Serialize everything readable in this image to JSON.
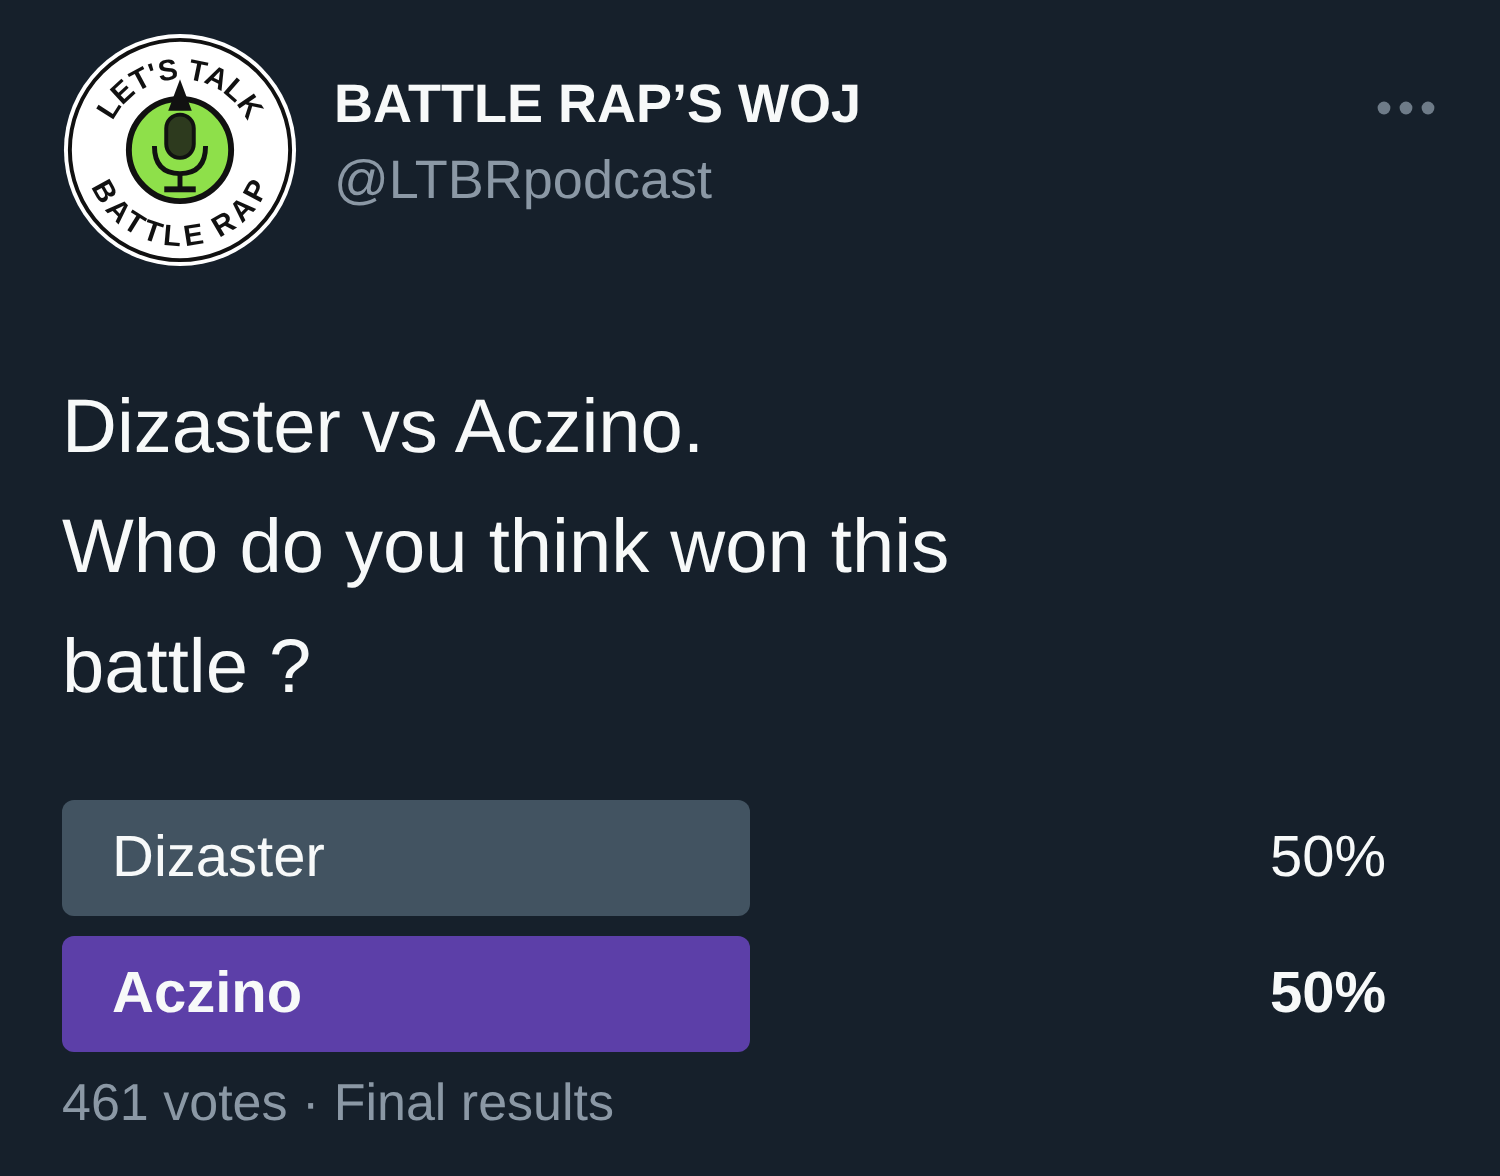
{
  "avatar": {
    "top_text": "LET'S TALK",
    "bottom_text": "BATTLE RAP"
  },
  "author": {
    "name": "BATTLE RAP’S WOJ",
    "handle": "@LTBRpodcast"
  },
  "tweet_text": [
    "Dizaster vs Aczino.",
    "Who do you think won this",
    "battle ?"
  ],
  "poll": {
    "options": [
      {
        "label": "Dizaster",
        "percent": "50%",
        "winner": false
      },
      {
        "label": "Aczino",
        "percent": "50%",
        "winner": true
      }
    ],
    "footer": "461 votes · Final results"
  }
}
